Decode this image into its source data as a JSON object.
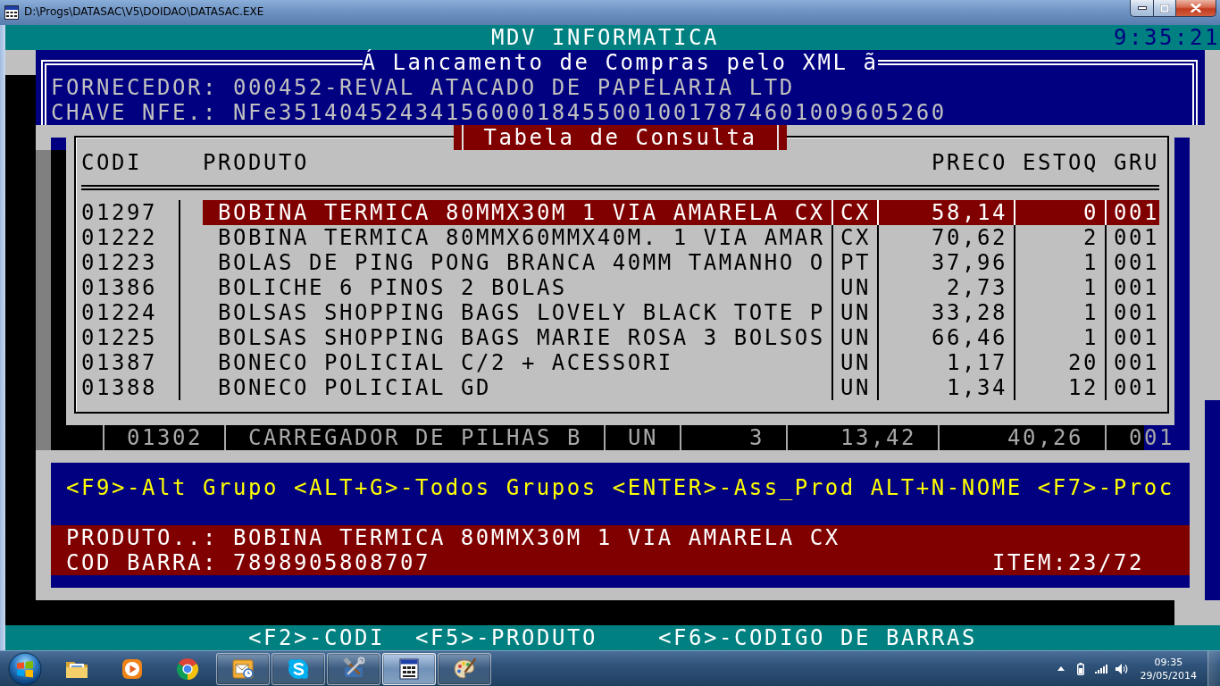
{
  "window": {
    "title": "D:\\Progs\\DATASAC\\V5\\DOIDAO\\DATASAC.EXE"
  },
  "header_bar": {
    "title": "MDV INFORMATICA",
    "clock": "9:35:21"
  },
  "supplier_panel": {
    "title": "Á Lancamento de Compras pelo XML ã",
    "fields": [
      {
        "label": "FORNECEDOR:",
        "value": "000452-REVAL ATACADO DE PAPELARIA LTD"
      },
      {
        "label": "CHAVE NFE.:",
        "value": "NFe35140452434156000184550010017874601009605260"
      }
    ]
  },
  "background_table": {
    "rows": [
      {
        "cells": [
          "01302",
          "CARREGADOR DE PILHAS B",
          "UN",
          "3",
          "13,42",
          "40,26",
          "001"
        ]
      }
    ]
  },
  "lookup": {
    "title": "Tabela de Consulta",
    "columns": [
      "CODI",
      "PRODUTO",
      "PRECO",
      "ESTOQ",
      "GRU"
    ],
    "rows": [
      {
        "code": "01297",
        "product": "BOBINA TERMICA 80MMX30M 1 VIA AMARELA CX",
        "unit": "CX",
        "price": "58,14",
        "stock": "0",
        "group": "001",
        "selected": true
      },
      {
        "code": "01222",
        "product": "BOBINA TERMICA 80MMX60MMX40M. 1 VIA AMAR",
        "unit": "CX",
        "price": "70,62",
        "stock": "2",
        "group": "001",
        "selected": false
      },
      {
        "code": "01223",
        "product": "BOLAS DE PING PONG BRANCA 40MM TAMANHO O",
        "unit": "PT",
        "price": "37,96",
        "stock": "1",
        "group": "001",
        "selected": false
      },
      {
        "code": "01386",
        "product": "BOLICHE 6 PINOS 2 BOLAS",
        "unit": "UN",
        "price": "2,73",
        "stock": "1",
        "group": "001",
        "selected": false
      },
      {
        "code": "01224",
        "product": "BOLSAS SHOPPING BAGS LOVELY BLACK TOTE P",
        "unit": "UN",
        "price": "33,28",
        "stock": "1",
        "group": "001",
        "selected": false
      },
      {
        "code": "01225",
        "product": "BOLSAS SHOPPING BAGS MARIE ROSA 3 BOLSOS",
        "unit": "UN",
        "price": "66,46",
        "stock": "1",
        "group": "001",
        "selected": false
      },
      {
        "code": "01387",
        "product": "BONECO POLICIAL C/2 + ACESSORI",
        "unit": "UN",
        "price": "1,17",
        "stock": "20",
        "group": "001",
        "selected": false
      },
      {
        "code": "01388",
        "product": "BONECO POLICIAL GD",
        "unit": "UN",
        "price": "1,34",
        "stock": "12",
        "group": "001",
        "selected": false
      }
    ]
  },
  "hints": [
    "<F9>-Alt Grupo",
    "<ALT+G>-Todos Grupos",
    "<ENTER>-Ass_Prod",
    "ALT+N-NOME",
    "<F7>-Proc"
  ],
  "selection_info": {
    "fields": [
      {
        "label": "PRODUTO..:",
        "value": "BOBINA TERMICA 80MMX30M 1 VIA AMARELA CX"
      },
      {
        "label": "COD BARRA:",
        "value": "7898905808707"
      }
    ],
    "item": "ITEM:23/72"
  },
  "footer_hints": [
    "<F2>-CODI",
    "<F5>-PRODUTO",
    "<F6>-CODIGO DE BARRAS"
  ],
  "taskbar": {
    "apps": [
      {
        "kind": "folder",
        "running": false,
        "selected": false
      },
      {
        "kind": "media",
        "running": false,
        "selected": false
      },
      {
        "kind": "browser",
        "running": false,
        "selected": false
      },
      {
        "kind": "mail",
        "running": true,
        "selected": false
      },
      {
        "kind": "chat",
        "running": true,
        "selected": false
      },
      {
        "kind": "tools",
        "running": true,
        "selected": false
      },
      {
        "kind": "console",
        "running": true,
        "selected": true
      },
      {
        "kind": "paint",
        "running": true,
        "selected": false
      }
    ],
    "clock": {
      "time": "09:35",
      "date": "29/05/2014"
    }
  }
}
